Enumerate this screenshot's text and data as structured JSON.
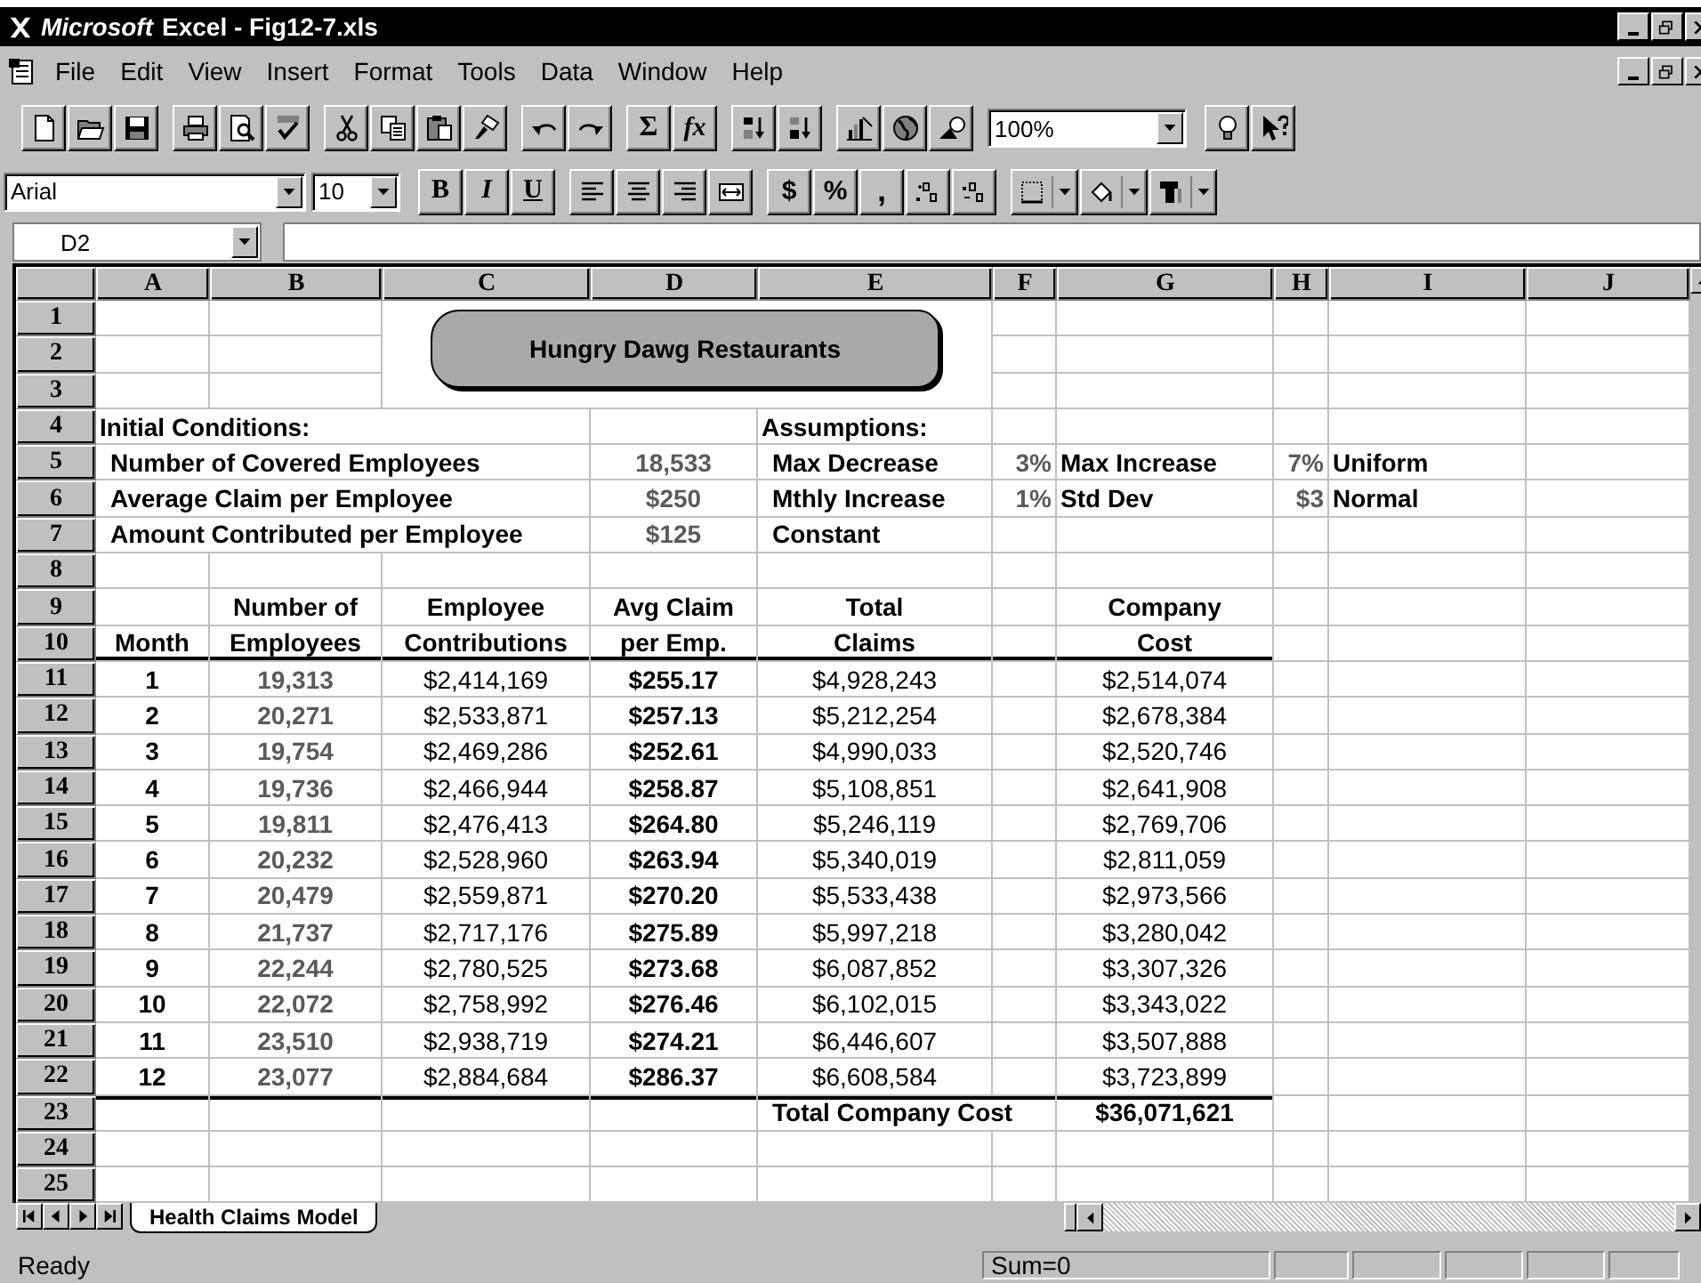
{
  "window": {
    "brand": "Microsoft",
    "title": "Excel - Fig12-7.xls"
  },
  "menu": [
    "File",
    "Edit",
    "View",
    "Insert",
    "Format",
    "Tools",
    "Data",
    "Window",
    "Help"
  ],
  "standard_toolbar": {
    "autosum": "Σ",
    "function": "fx",
    "zoom": "100%"
  },
  "formatting_toolbar": {
    "font": "Arial",
    "size": "10",
    "bold": "B",
    "italic": "I",
    "underline": "U",
    "currency": "$",
    "percent": "%",
    "comma": ","
  },
  "name_box": "D2",
  "columns": [
    "A",
    "B",
    "C",
    "D",
    "E",
    "F",
    "G",
    "H",
    "I",
    "J"
  ],
  "banner": "Hungry Dawg Restaurants",
  "rows": [
    {
      "n": "1",
      "kind": "blank"
    },
    {
      "n": "2",
      "kind": "blank"
    },
    {
      "n": "3",
      "kind": "blank"
    },
    {
      "n": "4",
      "kind": "section",
      "A": "Initial Conditions:",
      "E": "Assumptions:"
    },
    {
      "n": "5",
      "kind": "input",
      "A": "Number of Covered Employees",
      "D": "18,533",
      "E": "Max Decrease",
      "F": "3%",
      "G": "Max Increase",
      "H": "7%",
      "I": "Uniform"
    },
    {
      "n": "6",
      "kind": "input",
      "A": "Average Claim per Employee",
      "D": "$250",
      "E": "Mthly Increase",
      "F": "1%",
      "G": "Std Dev",
      "H": "$3",
      "I": "Normal"
    },
    {
      "n": "7",
      "kind": "input",
      "A": "Amount Contributed per Employee",
      "D": "$125",
      "E": "Constant"
    },
    {
      "n": "8",
      "kind": "blank"
    },
    {
      "n": "9",
      "kind": "header",
      "B": "Number of",
      "C": "Employee",
      "D": "Avg Claim",
      "E": "Total",
      "G": "Company"
    },
    {
      "n": "10",
      "kind": "header",
      "A": "Month",
      "B": "Employees",
      "C": "Contributions",
      "D": "per Emp.",
      "E": "Claims",
      "G": "Cost"
    },
    {
      "n": "11",
      "kind": "data",
      "A": "1",
      "B": "19,313",
      "C": "$2,414,169",
      "D": "$255.17",
      "E": "$4,928,243",
      "G": "$2,514,074"
    },
    {
      "n": "12",
      "kind": "data",
      "A": "2",
      "B": "20,271",
      "C": "$2,533,871",
      "D": "$257.13",
      "E": "$5,212,254",
      "G": "$2,678,384"
    },
    {
      "n": "13",
      "kind": "data",
      "A": "3",
      "B": "19,754",
      "C": "$2,469,286",
      "D": "$252.61",
      "E": "$4,990,033",
      "G": "$2,520,746"
    },
    {
      "n": "14",
      "kind": "data",
      "A": "4",
      "B": "19,736",
      "C": "$2,466,944",
      "D": "$258.87",
      "E": "$5,108,851",
      "G": "$2,641,908"
    },
    {
      "n": "15",
      "kind": "data",
      "A": "5",
      "B": "19,811",
      "C": "$2,476,413",
      "D": "$264.80",
      "E": "$5,246,119",
      "G": "$2,769,706"
    },
    {
      "n": "16",
      "kind": "data",
      "A": "6",
      "B": "20,232",
      "C": "$2,528,960",
      "D": "$263.94",
      "E": "$5,340,019",
      "G": "$2,811,059"
    },
    {
      "n": "17",
      "kind": "data",
      "A": "7",
      "B": "20,479",
      "C": "$2,559,871",
      "D": "$270.20",
      "E": "$5,533,438",
      "G": "$2,973,566"
    },
    {
      "n": "18",
      "kind": "data",
      "A": "8",
      "B": "21,737",
      "C": "$2,717,176",
      "D": "$275.89",
      "E": "$5,997,218",
      "G": "$3,280,042"
    },
    {
      "n": "19",
      "kind": "data",
      "A": "9",
      "B": "22,244",
      "C": "$2,780,525",
      "D": "$273.68",
      "E": "$6,087,852",
      "G": "$3,307,326"
    },
    {
      "n": "20",
      "kind": "data",
      "A": "10",
      "B": "22,072",
      "C": "$2,758,992",
      "D": "$276.46",
      "E": "$6,102,015",
      "G": "$3,343,022"
    },
    {
      "n": "21",
      "kind": "data",
      "A": "11",
      "B": "23,510",
      "C": "$2,938,719",
      "D": "$274.21",
      "E": "$6,446,607",
      "G": "$3,507,888"
    },
    {
      "n": "22",
      "kind": "data",
      "A": "12",
      "B": "23,077",
      "C": "$2,884,684",
      "D": "$286.37",
      "E": "$6,608,584",
      "G": "$3,723,899"
    },
    {
      "n": "23",
      "kind": "total",
      "E": "Total Company Cost",
      "G": "$36,071,621"
    },
    {
      "n": "24",
      "kind": "blank"
    },
    {
      "n": "25",
      "kind": "blank"
    }
  ],
  "sheet_tabs": [
    {
      "label": "Health Claims Model",
      "selected": true
    }
  ],
  "status_bar": {
    "mode": "Ready",
    "sum": "Sum=0"
  }
}
